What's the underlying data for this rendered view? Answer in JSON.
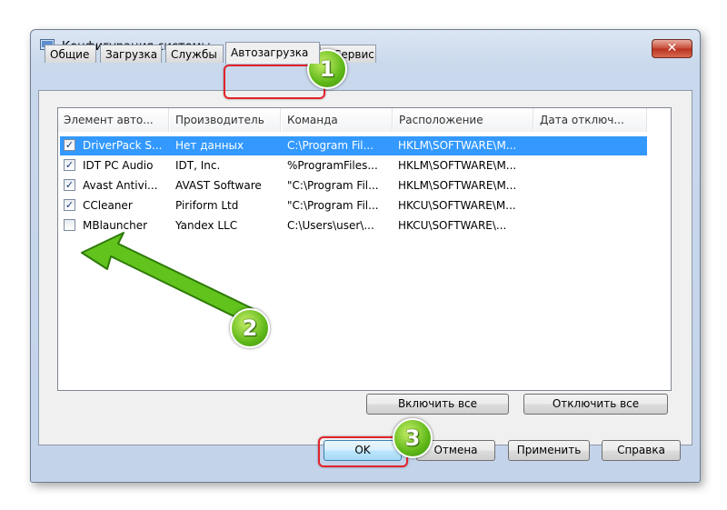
{
  "window": {
    "title": "Конфигурация системы",
    "close_label": "✕"
  },
  "tabs": [
    {
      "label": "Общие"
    },
    {
      "label": "Загрузка"
    },
    {
      "label": "Службы"
    },
    {
      "label": "Автозагрузка"
    },
    {
      "label": "Сервис"
    }
  ],
  "active_tab": "Автозагрузка",
  "columns": [
    "Элемент авто...",
    "Производитель",
    "Команда",
    "Расположение",
    "Дата отключ..."
  ],
  "rows": [
    {
      "checked": true,
      "selected": true,
      "name": "DriverPack S...",
      "vendor": "Нет данных",
      "command": "C:\\Program Fil...",
      "location": "HKLM\\SOFTWARE\\M..."
    },
    {
      "checked": true,
      "selected": false,
      "name": "IDT PC Audio",
      "vendor": "IDT, Inc.",
      "command": "%ProgramFiles...",
      "location": "HKLM\\SOFTWARE\\M..."
    },
    {
      "checked": true,
      "selected": false,
      "name": "Avast Antivi...",
      "vendor": "AVAST Software",
      "command": "\"C:\\Program Fil...",
      "location": "HKLM\\SOFTWARE\\M..."
    },
    {
      "checked": true,
      "selected": false,
      "name": "CCleaner",
      "vendor": "Piriform Ltd",
      "command": "\"C:\\Program Fil...",
      "location": "HKCU\\SOFTWARE\\M..."
    },
    {
      "checked": false,
      "selected": false,
      "name": "MBlauncher",
      "vendor": "Yandex LLC",
      "command": "C:\\Users\\user\\...",
      "location": "HKCU\\SOFTWARE\\..."
    }
  ],
  "panel_buttons": {
    "enable_all": "Включить все",
    "disable_all": "Отключить все"
  },
  "footer_buttons": {
    "ok": "OK",
    "cancel": "Отмена",
    "apply": "Применить",
    "help": "Справка"
  },
  "annotations": {
    "step1": "1",
    "step2": "2",
    "step3": "3"
  },
  "colors": {
    "highlight": "#3399ff",
    "annotation_red": "#e2232a",
    "annotation_green": "#5fb818"
  }
}
